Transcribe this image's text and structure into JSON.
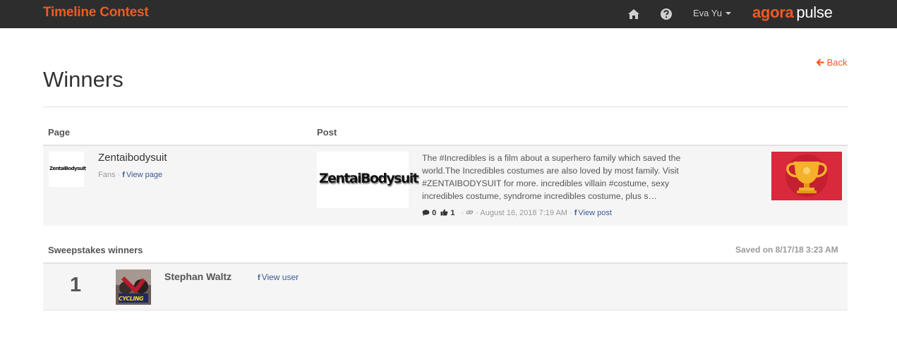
{
  "header": {
    "title": "Timeline Contest",
    "user_name": "Eva Yu",
    "brand_part1": "agora",
    "brand_part2": "pulse",
    "icons": [
      "home-icon",
      "question-circle-icon",
      "caret-down-icon"
    ]
  },
  "page": {
    "back_label": "Back",
    "title": "Winners"
  },
  "table": {
    "col_page": "Page",
    "col_post": "Post"
  },
  "post_row": {
    "page_thumb_text": "ZentaiBodysuit",
    "page_name": "Zentaibodysuit",
    "page_meta_prefix": "Fans ·",
    "view_page_label": "View page",
    "post_thumb_text": "ZentaiBodysuit",
    "post_text": "The #Incredibles is a film about a superhero family which saved the world.The Incredibles costumes are also loved by most family. Visit #ZENTAIBODYSUIT for more. incredibles villain #costume, sexy incredibles costume, syndrome incredibles costume, plus s…",
    "comments": "0",
    "likes": "1",
    "date": "· August 16, 2018 7:19 AM ·",
    "view_post_label": "View post"
  },
  "sweepstakes": {
    "title": "Sweepstakes winners",
    "saved_on": "Saved on 8/17/18 3:23 AM",
    "winners": [
      {
        "rank": "1",
        "name": "Stephan Waltz",
        "view_user_label": "View user",
        "avatar_text": "CYCLING"
      }
    ]
  },
  "colors": {
    "accent": "#f15a22",
    "topbar": "#2d2d2d",
    "link": "#3b5998",
    "trophy_bg": "#d8293d",
    "trophy_gold": "#f6b12c"
  }
}
